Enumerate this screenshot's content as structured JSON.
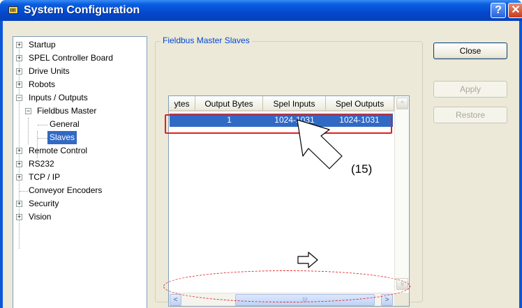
{
  "window": {
    "title": "System Configuration",
    "help_glyph": "?",
    "close_glyph": "✕"
  },
  "tree": {
    "items": [
      {
        "label": "Startup",
        "expander": "+"
      },
      {
        "label": "SPEL Controller Board",
        "expander": "+"
      },
      {
        "label": "Drive Units",
        "expander": "+"
      },
      {
        "label": "Robots",
        "expander": "+"
      },
      {
        "label": "Inputs / Outputs",
        "expander": "−"
      },
      {
        "label": "Fieldbus Master",
        "expander": "−"
      },
      {
        "label": "General",
        "expander": ""
      },
      {
        "label": "Slaves",
        "expander": "",
        "selected": true
      },
      {
        "label": "Remote Control",
        "expander": "+"
      },
      {
        "label": "RS232",
        "expander": "+"
      },
      {
        "label": "TCP / IP",
        "expander": "+"
      },
      {
        "label": "Conveyor Encoders",
        "expander": ""
      },
      {
        "label": "Security",
        "expander": "+"
      },
      {
        "label": "Vision",
        "expander": "+"
      }
    ]
  },
  "group": {
    "title": "Fieldbus Master Slaves"
  },
  "grid": {
    "columns": [
      "ytes",
      "Output Bytes",
      "Spel Inputs",
      "Spel Outputs"
    ],
    "rows": [
      [
        "",
        "1",
        "1024-1031",
        "1024-1031"
      ]
    ],
    "scroll_up": "^",
    "scroll_down": "v",
    "scroll_left": "<",
    "scroll_right": ">",
    "thumb_grip": "III"
  },
  "buttons": {
    "close": "Close",
    "apply": "Apply",
    "restore": "Restore"
  },
  "annotation": {
    "label": "(15)"
  },
  "colors": {
    "selection": "#316ac5",
    "annotation": "#e02020",
    "titlebar": "#0548cf"
  }
}
